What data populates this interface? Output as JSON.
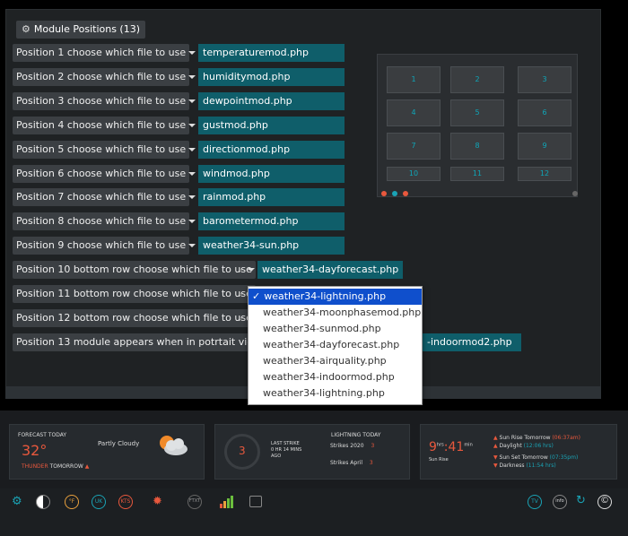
{
  "panel": {
    "title": "Module Positions (13)"
  },
  "positions": [
    {
      "label": "Position 1 choose which file to use",
      "value": "temperaturemod.php"
    },
    {
      "label": "Position 2 choose which file to use",
      "value": "humiditymod.php"
    },
    {
      "label": "Position 3 choose which file to use",
      "value": "dewpointmod.php"
    },
    {
      "label": "Position 4 choose which file to use",
      "value": "gustmod.php"
    },
    {
      "label": "Position 5 choose which file to use",
      "value": "directionmod.php"
    },
    {
      "label": "Position 6 choose which file to use",
      "value": "windmod.php"
    },
    {
      "label": "Position 7 choose which file to use",
      "value": "rainmod.php"
    },
    {
      "label": "Position 8 choose which file to use",
      "value": "barometermod.php"
    },
    {
      "label": "Position 9 choose which file to use",
      "value": "weather34-sun.php"
    },
    {
      "label": "Position 10 bottom row choose which file to use",
      "value": "weather34-dayforecast.php"
    },
    {
      "label": "Position 11 bottom row choose which file to use",
      "value": ""
    },
    {
      "label": "Position 12 bottom row choose which file to use",
      "value": ""
    },
    {
      "label": "Position 13 module appears when in potrtait view ch",
      "value": "-indoormod2.php"
    }
  ],
  "preview_grid": [
    "1",
    "2",
    "3",
    "4",
    "5",
    "6",
    "7",
    "8",
    "9",
    "10",
    "11",
    "12"
  ],
  "preview_dot_colors": [
    "#e8583d",
    "#1aa3b5",
    "#e8583d"
  ],
  "dropdown": {
    "selected": "weather34-lightning.php",
    "options": [
      "weather34-moonphasemod.php",
      "weather34-sunmod.php",
      "weather34-dayforecast.php",
      "weather34-airquality.php",
      "weather34-indoormod.php",
      "weather34-lightning.php"
    ]
  },
  "forecast": {
    "heading": "FORECAST TODAY",
    "temp": "32°",
    "condition": "Partly Cloudy",
    "tomorrow_prefix": "THUNDER",
    "tomorrow_label": "TOMORROW"
  },
  "lightning": {
    "count": "3",
    "last_strike_label": "LAST STRIKE",
    "last_strike_value": "0 HR 14 MINS",
    "ago": "AGO",
    "heading": "LIGHTNING TODAY",
    "strikes_year_label": "Strikes 2020",
    "strikes_year_value": "3",
    "strikes_month_label": "Strikes April",
    "strikes_month_value": "3"
  },
  "sun": {
    "hours": "9",
    "hrs_label": "hrs",
    "minutes": "41",
    "min_label": "min",
    "sunrise_label": "Sun Rise",
    "sunrise_tomorrow_label": "Sun Rise Tomorrow",
    "sunrise_tomorrow_value": "(06:37am)",
    "daylight_label": "Daylight",
    "daylight_value": "(12:06 hrs)",
    "sunset_tomorrow_label": "Sun Set Tomorrow",
    "sunset_tomorrow_value": "(07:35pm)",
    "darkness_label": "Darkness",
    "darkness_value": "(11:54 hrs)"
  },
  "toolbar": {
    "fahrenheit": "°F",
    "uk": "UK",
    "kts": "KTS",
    "ftxt": "FTXT",
    "tv": "TV",
    "info": "info"
  },
  "colors": {
    "value_bg": "#0f5e6a",
    "accent_teal": "#1aa3b5",
    "accent_orange": "#e8583d",
    "select_blue": "#0f4fcc"
  }
}
